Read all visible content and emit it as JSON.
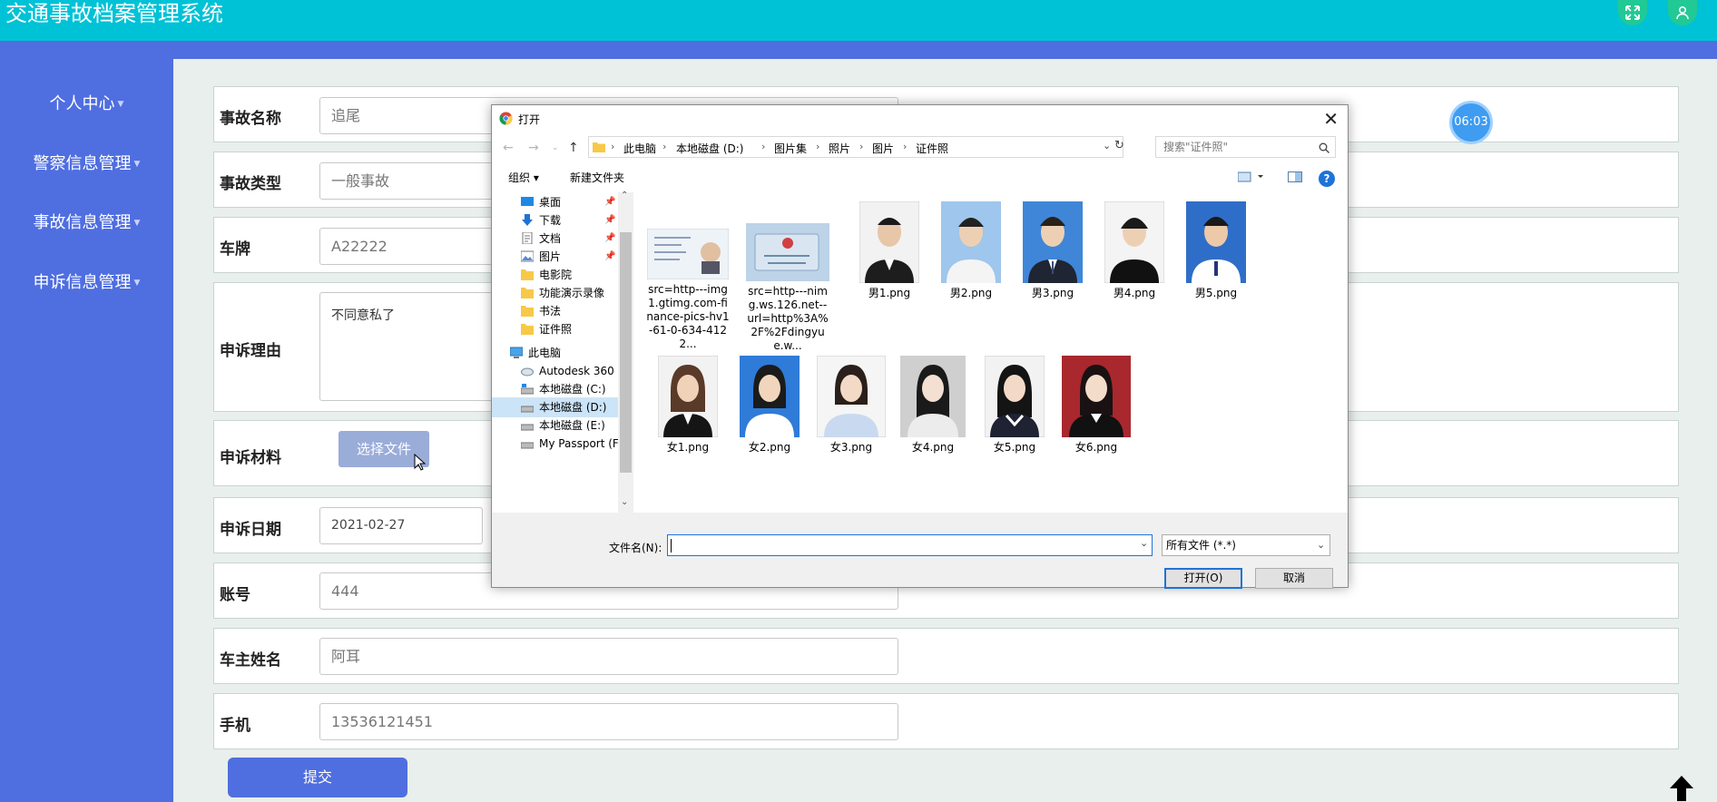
{
  "app": {
    "title": "交通事故档案管理系统"
  },
  "sidebar": {
    "items": [
      {
        "label": "个人中心"
      },
      {
        "label": "警察信息管理"
      },
      {
        "label": "事故信息管理"
      },
      {
        "label": "申诉信息管理"
      }
    ]
  },
  "form": {
    "accident_name": {
      "label": "事故名称",
      "value": "追尾"
    },
    "accident_type": {
      "label": "事故类型",
      "value": "一般事故"
    },
    "plate": {
      "label": "车牌",
      "value": "A22222"
    },
    "reason": {
      "label": "申诉理由",
      "value": "不同意私了"
    },
    "material": {
      "label": "申诉材料",
      "button": "选择文件"
    },
    "date": {
      "label": "申诉日期",
      "value": "2021-02-27"
    },
    "account": {
      "label": "账号",
      "value": "444"
    },
    "owner": {
      "label": "车主姓名",
      "value": "阿耳"
    },
    "phone": {
      "label": "手机",
      "value": "13536121451"
    },
    "submit_label": "提交"
  },
  "timer": "06:03",
  "dialog": {
    "title": "打开",
    "breadcrumb": [
      "此电脑",
      "本地磁盘 (D:)",
      "图片集",
      "照片",
      "图片",
      "证件照"
    ],
    "search_placeholder": "搜索\"证件照\"",
    "toolbar": {
      "organize": "组织",
      "new_folder": "新建文件夹"
    },
    "nav_items": [
      {
        "label": "桌面",
        "pinned": true
      },
      {
        "label": "下载",
        "pinned": true
      },
      {
        "label": "文档",
        "pinned": true
      },
      {
        "label": "图片",
        "pinned": true
      },
      {
        "label": "电影院"
      },
      {
        "label": "功能演示录像"
      },
      {
        "label": "书法"
      },
      {
        "label": "证件照"
      },
      {
        "label": "此电脑"
      },
      {
        "label": "Autodesk 360"
      },
      {
        "label": "本地磁盘 (C:)"
      },
      {
        "label": "本地磁盘 (D:)",
        "selected": true
      },
      {
        "label": "本地磁盘 (E:)"
      },
      {
        "label": "My Passport (F"
      }
    ],
    "files": [
      {
        "name": "src=http---img1.gtimg.com-finance-pics-hv1-61-0-634-4122...",
        "kind": "doc"
      },
      {
        "name": "src=http---nimg.ws.126.net--url=http%3A%2F%2Fdingyue.w...",
        "kind": "id"
      },
      {
        "name": "男1.png",
        "kind": "m1"
      },
      {
        "name": "男2.png",
        "kind": "m2"
      },
      {
        "name": "男3.png",
        "kind": "m3"
      },
      {
        "name": "男4.png",
        "kind": "m4"
      },
      {
        "name": "男5.png",
        "kind": "m5"
      },
      {
        "name": "女1.png",
        "kind": "f1"
      },
      {
        "name": "女2.png",
        "kind": "f2"
      },
      {
        "name": "女3.png",
        "kind": "f3"
      },
      {
        "name": "女4.png",
        "kind": "f4"
      },
      {
        "name": "女5.png",
        "kind": "f5"
      },
      {
        "name": "女6.png",
        "kind": "f6"
      }
    ],
    "filename_label": "文件名(N):",
    "filename_value": "",
    "filetype": "所有文件 (*.*)",
    "open_label": "打开(O)",
    "cancel_label": "取消"
  },
  "colors": {
    "header": "#00c2d6",
    "sidebar": "#4f6ee0",
    "accent": "#1e73d8"
  }
}
